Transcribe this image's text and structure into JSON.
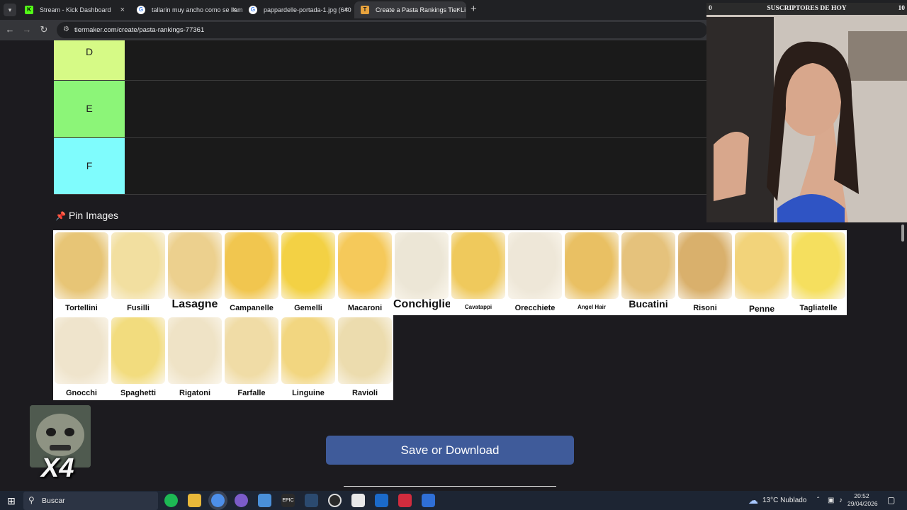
{
  "browser": {
    "tabs": [
      {
        "title": "Stream - Kick Dashboard",
        "favicon": "K",
        "favicon_color": "#53fc18"
      },
      {
        "title": "tallarin muy ancho como se llam",
        "favicon": "G",
        "favicon_color": "#ffffff"
      },
      {
        "title": "pappardelle-portada-1.jpg (640",
        "favicon": "G",
        "favicon_color": "#ffffff"
      },
      {
        "title": "Create a Pasta Rankings Tier Li",
        "favicon": "T",
        "favicon_color": "#e8a33d"
      }
    ],
    "close_glyph": "×",
    "new_tab_glyph": "+",
    "url": "tiermaker.com/create/pasta-rankings-77361"
  },
  "tiers": [
    {
      "label": "D",
      "color": "#d6fa86"
    },
    {
      "label": "E",
      "color": "#8cf578"
    },
    {
      "label": "F",
      "color": "#7ffcfd"
    }
  ],
  "pin_images": {
    "title": "Pin Images"
  },
  "pasta_items": [
    {
      "name": "Tortellini",
      "color": "#e7c576"
    },
    {
      "name": "Fusilli",
      "color": "#f2dfa0"
    },
    {
      "name": "Lasagne",
      "color": "#ecd08e"
    },
    {
      "name": "Campanelle",
      "color": "#f1c64f"
    },
    {
      "name": "Gemelli",
      "color": "#f3d144"
    },
    {
      "name": "Macaroni",
      "color": "#f5c95a"
    },
    {
      "name": "Conchiglie",
      "color": "#ece6d6"
    },
    {
      "name": "Cavatappi",
      "color": "#efc95c"
    },
    {
      "name": "Orecchiete",
      "color": "#eee7d8"
    },
    {
      "name": "Angel Hair",
      "color": "#e9c063"
    },
    {
      "name": "Bucatini",
      "color": "#e5c27c"
    },
    {
      "name": "Risoni",
      "color": "#d9b06c"
    },
    {
      "name": "Penne",
      "color": "#f2d37a"
    },
    {
      "name": "Tagliatelle",
      "color": "#f5df5e"
    },
    {
      "name": "Gnocchi",
      "color": "#efe4cc"
    },
    {
      "name": "Spaghetti",
      "color": "#f2dc7e"
    },
    {
      "name": "Rigatoni",
      "color": "#efe3c6"
    },
    {
      "name": "Farfalle",
      "color": "#f0dca6"
    },
    {
      "name": "Linguine",
      "color": "#f2d680"
    },
    {
      "name": "Ravioli",
      "color": "#ecdcae"
    }
  ],
  "save_button": "Save or Download",
  "webcam": {
    "counter_left": "0",
    "title": "SUSCRIPTORES DE HOY",
    "counter_right": "10"
  },
  "sticker": {
    "multiplier": "X4"
  },
  "taskbar": {
    "search_placeholder": "Buscar",
    "weather": "13°C  Nublado",
    "time": "20:52",
    "date": "29/04/2026"
  }
}
